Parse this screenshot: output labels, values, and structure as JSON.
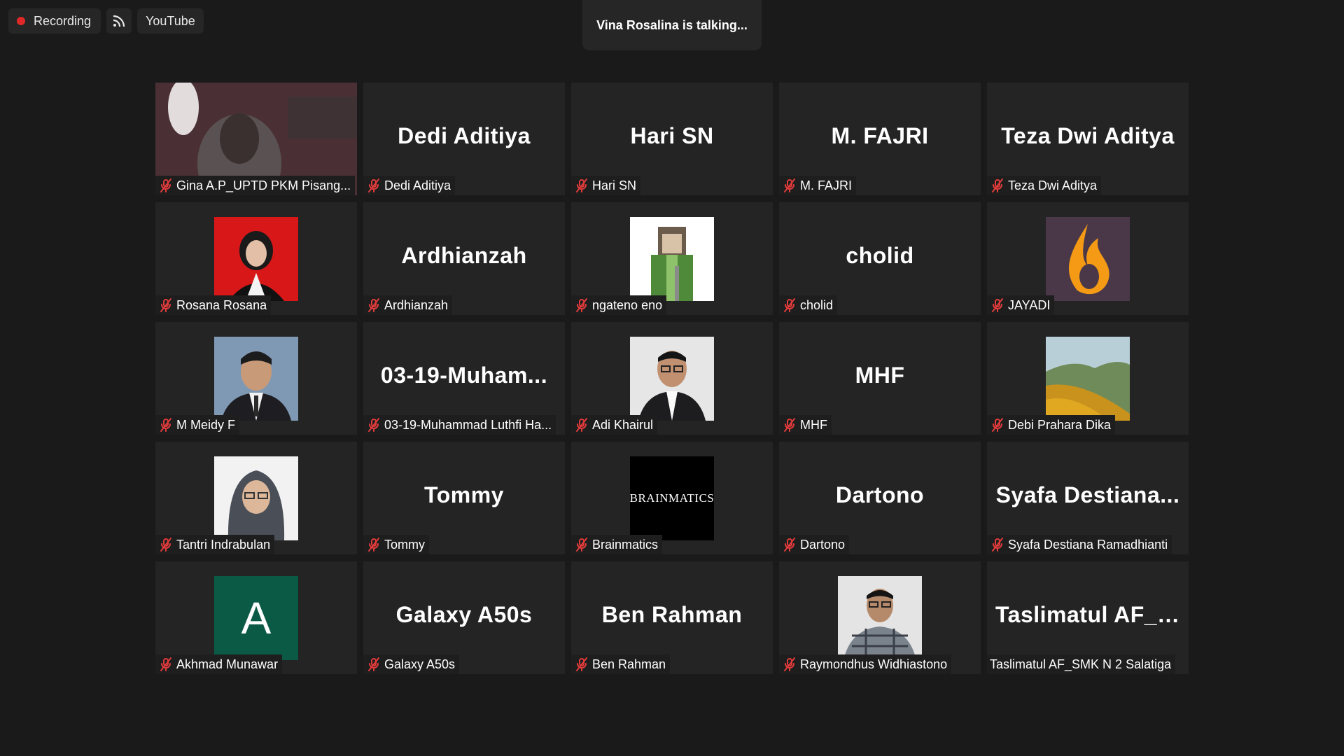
{
  "topbar": {
    "recording_label": "Recording",
    "rss_icon": "rss-icon",
    "youtube_label": "YouTube",
    "recording_color": "#e02828"
  },
  "talking_banner": "Vina Rosalina is talking...",
  "colors": {
    "background": "#1a1a1a",
    "tile": "#242424",
    "muted_mic": "#e23b3b"
  },
  "tiles": [
    {
      "big": "",
      "label": "Gina A.P_UPTD PKM Pisang...",
      "media": "video",
      "muted": true
    },
    {
      "big": "Dedi Aditiya",
      "label": "Dedi Aditiya",
      "media": "none",
      "muted": true
    },
    {
      "big": "Hari SN",
      "label": "Hari SN",
      "media": "none",
      "muted": true
    },
    {
      "big": "M. FAJRI",
      "label": "M. FAJRI",
      "media": "none",
      "muted": true
    },
    {
      "big": "Teza Dwi Aditya",
      "label": "Teza Dwi Aditya",
      "media": "none",
      "muted": true
    },
    {
      "big": "",
      "label": "Rosana Rosana",
      "media": "photo-woman-red",
      "muted": true
    },
    {
      "big": "Ardhianzah",
      "label": "Ardhianzah",
      "media": "none",
      "muted": true
    },
    {
      "big": "",
      "label": "ngateno eno",
      "media": "photo-cartoon-warrior",
      "muted": true
    },
    {
      "big": "cholid",
      "label": "cholid",
      "media": "none",
      "muted": true
    },
    {
      "big": "",
      "label": "JAYADI",
      "media": "photo-flame",
      "muted": true
    },
    {
      "big": "",
      "label": "M Meidy F",
      "media": "photo-man-suit",
      "muted": true
    },
    {
      "big": "03-19-Muham...",
      "label": "03-19-Muhammad Luthfi Ha...",
      "media": "none",
      "muted": true
    },
    {
      "big": "",
      "label": "Adi Khairul",
      "media": "photo-man-glasses",
      "muted": true
    },
    {
      "big": "MHF",
      "label": "MHF",
      "media": "none",
      "muted": true
    },
    {
      "big": "",
      "label": "Debi Prahara Dika",
      "media": "photo-landscape",
      "muted": true
    },
    {
      "big": "",
      "label": "Tantri Indrabulan",
      "media": "photo-woman-hijab",
      "muted": true
    },
    {
      "big": "Tommy",
      "label": "Tommy",
      "media": "none",
      "muted": true
    },
    {
      "big": "",
      "label": "Brainmatics",
      "media": "logo-brainmatics",
      "muted": true,
      "logo_text": "BRAINMATICS"
    },
    {
      "big": "Dartono",
      "label": "Dartono",
      "media": "none",
      "muted": true
    },
    {
      "big": "Syafa  Destiana...",
      "label": "Syafa Destiana Ramadhianti",
      "media": "none",
      "muted": true
    },
    {
      "big": "",
      "label": "Akhmad Munawar",
      "media": "letter-avatar",
      "muted": true,
      "letter": "A",
      "letter_bg": "#0b5a46"
    },
    {
      "big": "Galaxy A50s",
      "label": "Galaxy A50s",
      "media": "none",
      "muted": true
    },
    {
      "big": "Ben Rahman",
      "label": "Ben Rahman",
      "media": "none",
      "muted": true
    },
    {
      "big": "",
      "label": "Raymondhus Widhiastono",
      "media": "photo-man-plaid",
      "muted": true
    },
    {
      "big": "Taslimatul  AF_S...",
      "label": "Taslimatul AF_SMK N 2 Salatiga",
      "media": "none",
      "muted": false
    }
  ]
}
